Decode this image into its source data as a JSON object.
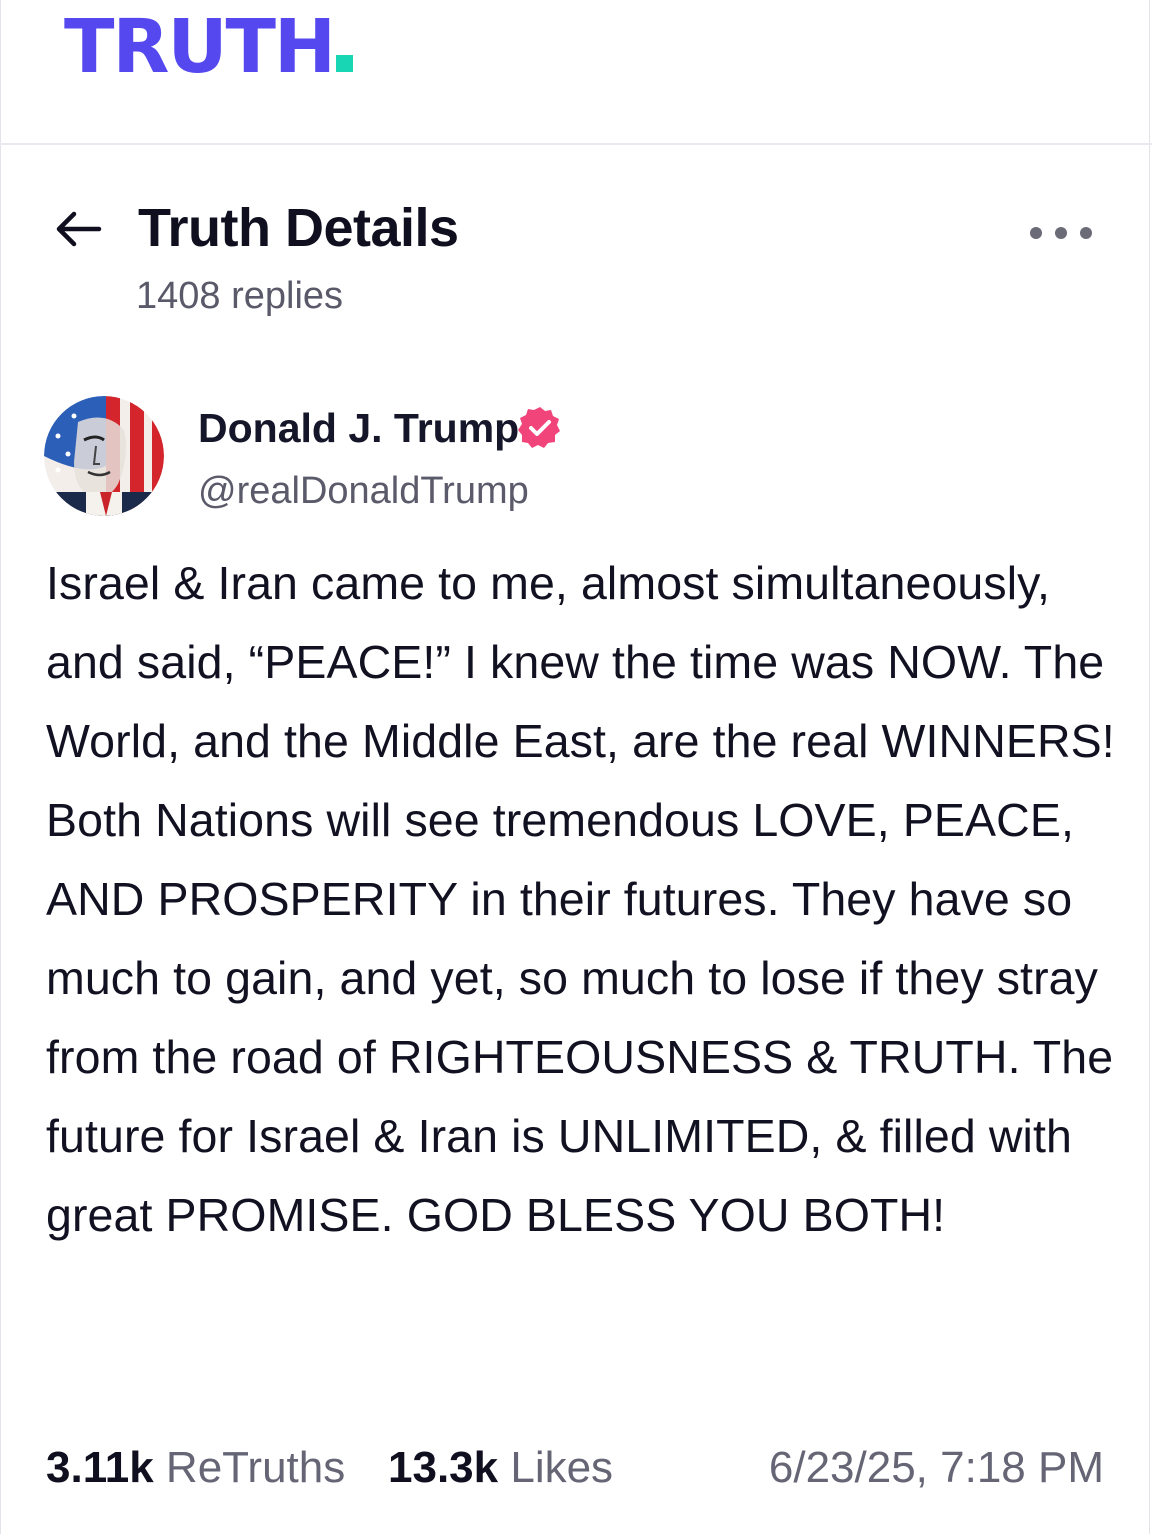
{
  "header": {
    "logo_text": "TRUTH",
    "logo_color": "#5448ee",
    "logo_dot_color": "#18d6b4"
  },
  "page": {
    "back_icon": "arrow-left-icon",
    "title": "Truth Details",
    "reply_count": "1408 replies",
    "more_icon": "ellipsis-icon"
  },
  "post": {
    "author": {
      "name": "Donald J. Trump",
      "handle": "@realDonaldTrump",
      "verified_icon": "verified-badge-icon",
      "verified_color": "#f0447a"
    },
    "body": "Israel & Iran came to me, almost simultaneously, and said, “PEACE!” I knew the time was NOW. The World, and the Middle East, are the real WINNERS! Both Nations will see tremendous LOVE, PEACE, AND PROSPERITY in their futures. They have so much to gain, and yet, so much to lose if they stray from the road of RIGHTEOUSNESS & TRUTH. The future for Israel & Iran is UNLIMITED, & filled with great PROMISE. GOD BLESS YOU BOTH!",
    "stats": {
      "retruths_count": "3.11k",
      "retruths_label": "ReTruths",
      "likes_count": "13.3k",
      "likes_label": "Likes"
    },
    "timestamp": "6/23/25, 7:18 PM"
  }
}
